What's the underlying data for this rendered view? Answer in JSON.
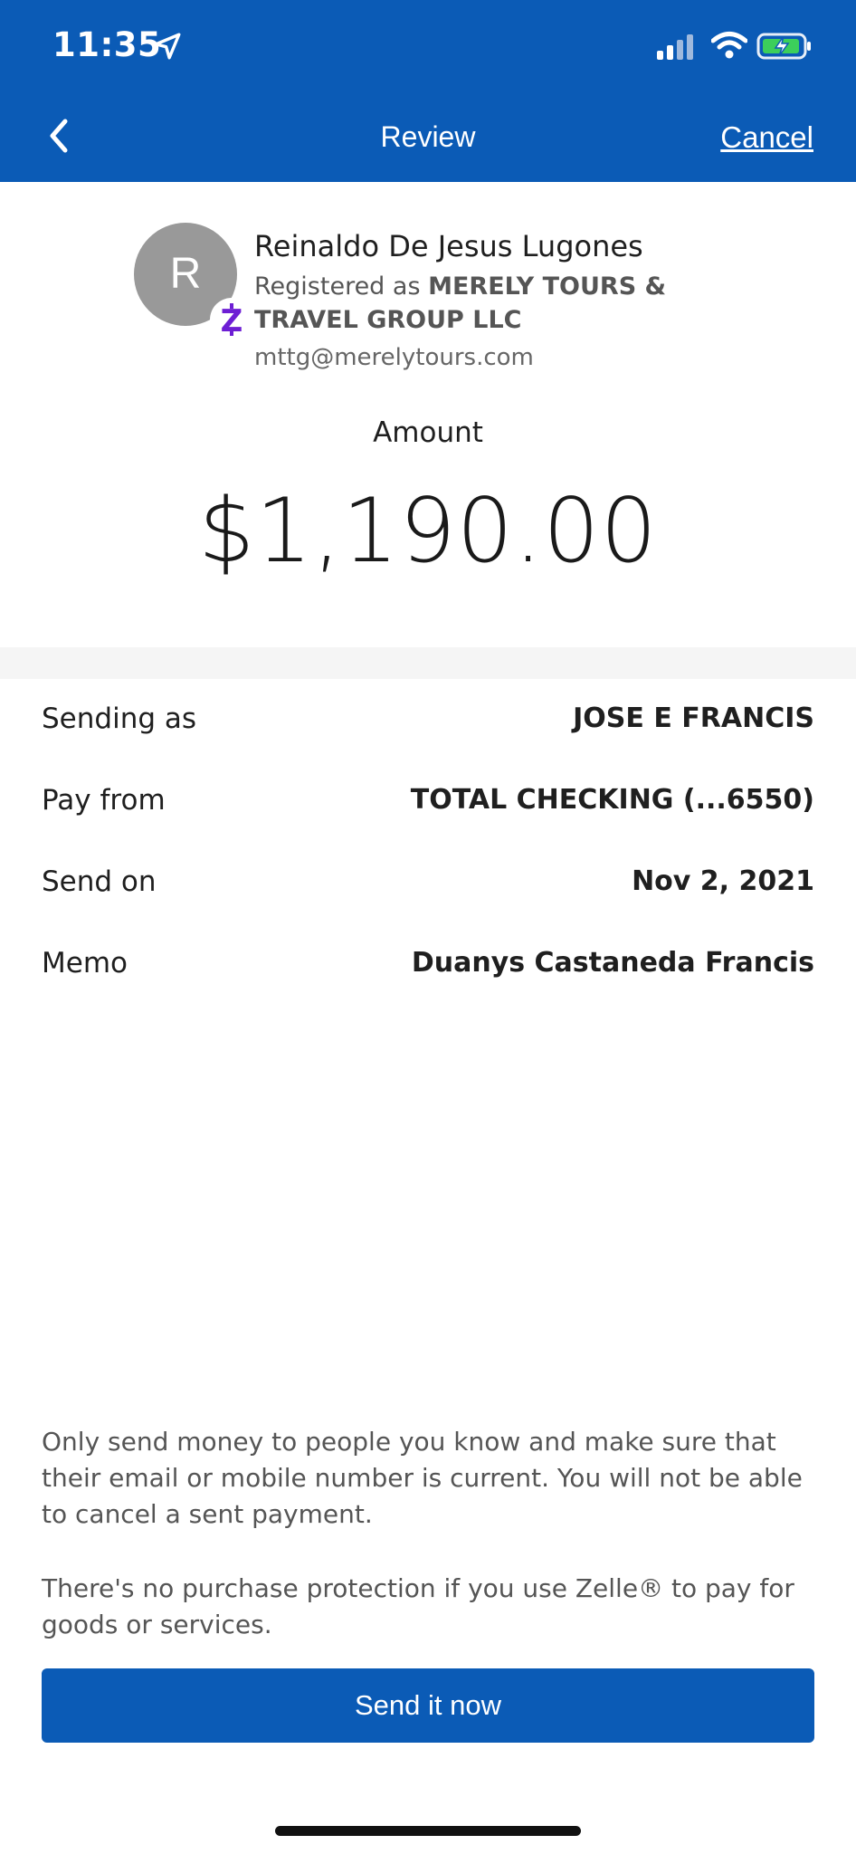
{
  "status_bar": {
    "time": "11:35",
    "icons": [
      "location-arrow-icon",
      "cellular-signal-icon",
      "wifi-icon",
      "battery-charging-icon"
    ]
  },
  "nav": {
    "back_icon": "chevron-left-icon",
    "title": "Review",
    "cancel_label": "Cancel"
  },
  "recipient": {
    "avatar_initial": "R",
    "name": "Reinaldo De Jesus Lugones",
    "registered_prefix": "Registered as ",
    "registered_name": "MERELY TOURS & TRAVEL GROUP LLC",
    "email": "mttg@merelytours.com",
    "badge_icon": "zelle-icon"
  },
  "amount": {
    "label": "Amount",
    "value": "$1,190.00"
  },
  "details": [
    {
      "label": "Sending as",
      "value": "JOSE E FRANCIS"
    },
    {
      "label": "Pay from",
      "value": "TOTAL CHECKING (...6550)"
    },
    {
      "label": "Send on",
      "value": "Nov 2, 2021"
    },
    {
      "label": "Memo",
      "value": "Duanys Castaneda Francis"
    }
  ],
  "disclaimers": [
    "Only send money to people you know and make sure that their email or mobile number is current. You will not be able to cancel a sent payment.",
    "There's no purchase protection if you use Zelle® to pay for goods or services."
  ],
  "send_button_label": "Send it now",
  "colors": {
    "brand_blue": "#0b5bb6",
    "zelle_purple": "#6d1ed4",
    "avatar_gray": "#999999"
  }
}
